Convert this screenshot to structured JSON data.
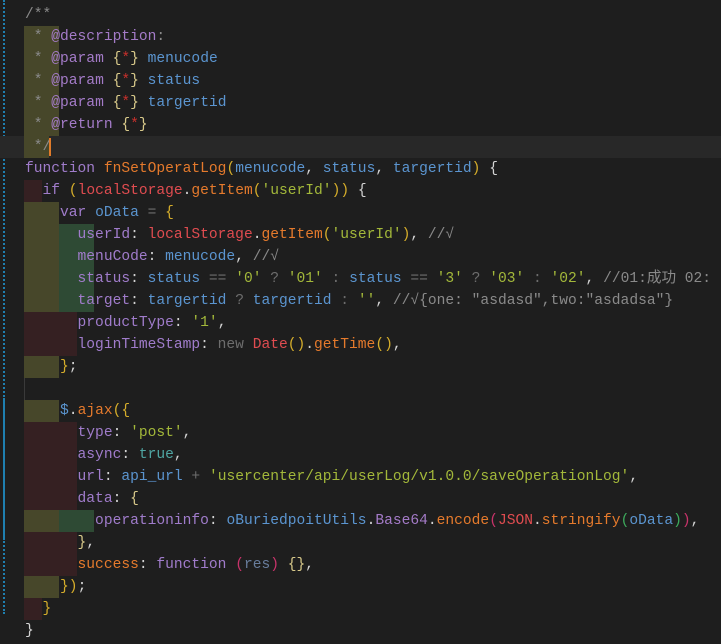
{
  "editor": {
    "lines": [
      [
        [
          "/**",
          "c"
        ]
      ],
      [
        [
          " * ",
          "c"
        ],
        [
          "@description",
          "t"
        ],
        [
          ":",
          "c"
        ]
      ],
      [
        [
          " * ",
          "c"
        ],
        [
          "@param",
          "t"
        ],
        [
          " ",
          ""
        ],
        [
          "{",
          "y"
        ],
        [
          "*",
          "r"
        ],
        [
          "}",
          "y"
        ],
        [
          " menucode",
          "b"
        ]
      ],
      [
        [
          " * ",
          "c"
        ],
        [
          "@param",
          "t"
        ],
        [
          " ",
          ""
        ],
        [
          "{",
          "y"
        ],
        [
          "*",
          "r"
        ],
        [
          "}",
          "y"
        ],
        [
          " status",
          "b"
        ]
      ],
      [
        [
          " * ",
          "c"
        ],
        [
          "@param",
          "t"
        ],
        [
          " ",
          ""
        ],
        [
          "{",
          "y"
        ],
        [
          "*",
          "r"
        ],
        [
          "}",
          "y"
        ],
        [
          " targertid",
          "b"
        ]
      ],
      [
        [
          " * ",
          "c"
        ],
        [
          "@return",
          "t"
        ],
        [
          " ",
          ""
        ],
        [
          "{",
          "y"
        ],
        [
          "*",
          "r"
        ],
        [
          "}",
          "y"
        ]
      ],
      [
        [
          " */",
          "c"
        ]
      ],
      [
        [
          "function ",
          "k"
        ],
        [
          "fnSetOperatLog",
          "f"
        ],
        [
          "(",
          "p"
        ],
        [
          "menucode",
          "b"
        ],
        [
          ", ",
          "w"
        ],
        [
          "status",
          "b"
        ],
        [
          ", ",
          "w"
        ],
        [
          "targertid",
          "b"
        ],
        [
          ")",
          "p"
        ],
        [
          " {",
          "w"
        ]
      ],
      [
        [
          "  if ",
          "k"
        ],
        [
          "(",
          "p"
        ],
        [
          "localStorage",
          "o"
        ],
        [
          ".",
          "w"
        ],
        [
          "getItem",
          "f"
        ],
        [
          "(",
          "p"
        ],
        [
          "'userId'",
          "s"
        ],
        [
          "))",
          "p"
        ],
        [
          " {",
          "w"
        ]
      ],
      [
        [
          "    var ",
          "k"
        ],
        [
          "oData",
          "b"
        ],
        [
          " = ",
          "op"
        ],
        [
          "{",
          "p"
        ]
      ],
      [
        [
          "      userId",
          "pr"
        ],
        [
          ": ",
          "w"
        ],
        [
          "localStorage",
          "o"
        ],
        [
          ".",
          "w"
        ],
        [
          "getItem",
          "f"
        ],
        [
          "(",
          "p"
        ],
        [
          "'userId'",
          "s"
        ],
        [
          ")",
          "p"
        ],
        [
          ", ",
          "w"
        ],
        [
          "//√",
          "c"
        ]
      ],
      [
        [
          "      menuCode",
          "pr"
        ],
        [
          ": ",
          "w"
        ],
        [
          "menucode",
          "b"
        ],
        [
          ", ",
          "w"
        ],
        [
          "//√",
          "c"
        ]
      ],
      [
        [
          "      status",
          "pr"
        ],
        [
          ": ",
          "w"
        ],
        [
          "status",
          "b"
        ],
        [
          " == ",
          "op"
        ],
        [
          "'0'",
          "s"
        ],
        [
          " ? ",
          "op"
        ],
        [
          "'01'",
          "s"
        ],
        [
          " : ",
          "op"
        ],
        [
          "status",
          "b"
        ],
        [
          " == ",
          "op"
        ],
        [
          "'3'",
          "s"
        ],
        [
          " ? ",
          "op"
        ],
        [
          "'03'",
          "s"
        ],
        [
          " : ",
          "op"
        ],
        [
          "'02'",
          "s"
        ],
        [
          ", ",
          "w"
        ],
        [
          "//01:成功 02:",
          "c"
        ]
      ],
      [
        [
          "      target",
          "pr"
        ],
        [
          ": ",
          "w"
        ],
        [
          "targertid",
          "b"
        ],
        [
          " ? ",
          "op"
        ],
        [
          "targertid",
          "b"
        ],
        [
          " : ",
          "op"
        ],
        [
          "''",
          "s"
        ],
        [
          ", ",
          "w"
        ],
        [
          "//√{one: \"asdasd\",two:\"asdadsa\"}",
          "c"
        ]
      ],
      [
        [
          "      productType",
          "pr"
        ],
        [
          ": ",
          "w"
        ],
        [
          "'1'",
          "s"
        ],
        [
          ",",
          "w"
        ]
      ],
      [
        [
          "      loginTimeStamp",
          "pr"
        ],
        [
          ": ",
          "w"
        ],
        [
          "new ",
          "op"
        ],
        [
          "Date",
          "o"
        ],
        [
          "()",
          "p"
        ],
        [
          ".",
          "w"
        ],
        [
          "getTime",
          "f"
        ],
        [
          "()",
          "p"
        ],
        [
          ",",
          "w"
        ]
      ],
      [
        [
          "    }",
          "p"
        ],
        [
          ";",
          "w"
        ]
      ],
      [],
      [
        [
          "    $",
          "b"
        ],
        [
          ".",
          "w"
        ],
        [
          "ajax",
          "f"
        ],
        [
          "(",
          "p"
        ],
        [
          "{",
          "p"
        ]
      ],
      [
        [
          "      type",
          "pr"
        ],
        [
          ": ",
          "w"
        ],
        [
          "'post'",
          "s"
        ],
        [
          ",",
          "w"
        ]
      ],
      [
        [
          "      async",
          "pr"
        ],
        [
          ": ",
          "w"
        ],
        [
          "true",
          "n"
        ],
        [
          ",",
          "w"
        ]
      ],
      [
        [
          "      url",
          "pr"
        ],
        [
          ": ",
          "w"
        ],
        [
          "api_url",
          "b"
        ],
        [
          " + ",
          "op"
        ],
        [
          "'usercenter/api/userLog/v1.0.0/saveOperationLog'",
          "s"
        ],
        [
          ",",
          "w"
        ]
      ],
      [
        [
          "      data",
          "pr"
        ],
        [
          ": ",
          "w"
        ],
        [
          "{",
          "y"
        ]
      ],
      [
        [
          "        operationinfo",
          "pr"
        ],
        [
          ": ",
          "w"
        ],
        [
          "oBuriedpoitUtils",
          "b"
        ],
        [
          ".",
          "w"
        ],
        [
          "Base64",
          "t"
        ],
        [
          ".",
          "w"
        ],
        [
          "encode",
          "f"
        ],
        [
          "(",
          "pk"
        ],
        [
          "JSON",
          "o"
        ],
        [
          ".",
          "w"
        ],
        [
          "stringify",
          "f"
        ],
        [
          "(",
          "gp"
        ],
        [
          "oData",
          "b"
        ],
        [
          ")",
          "gp"
        ],
        [
          ")",
          "pk"
        ],
        [
          ",",
          "w"
        ]
      ],
      [
        [
          "      }",
          "y"
        ],
        [
          ",",
          "w"
        ]
      ],
      [
        [
          "      success",
          "f"
        ],
        [
          ": ",
          "w"
        ],
        [
          "function ",
          "k"
        ],
        [
          "(",
          "pk"
        ],
        [
          "res",
          "rs"
        ],
        [
          ")",
          "pk"
        ],
        [
          " ",
          "w"
        ],
        [
          "{}",
          "y"
        ],
        [
          ",",
          "w"
        ]
      ],
      [
        [
          "    }",
          "p"
        ],
        [
          ")",
          "p"
        ],
        [
          ";",
          "w"
        ]
      ],
      [
        [
          "  }",
          "p"
        ]
      ],
      [
        [
          "}",
          "w"
        ]
      ]
    ],
    "colors": {
      "background": "#1e1e1e",
      "cursor": "#e07b2a",
      "indent_olive": "#47472a",
      "indent_green": "#2e4a34",
      "indent_red": "#352022"
    }
  }
}
